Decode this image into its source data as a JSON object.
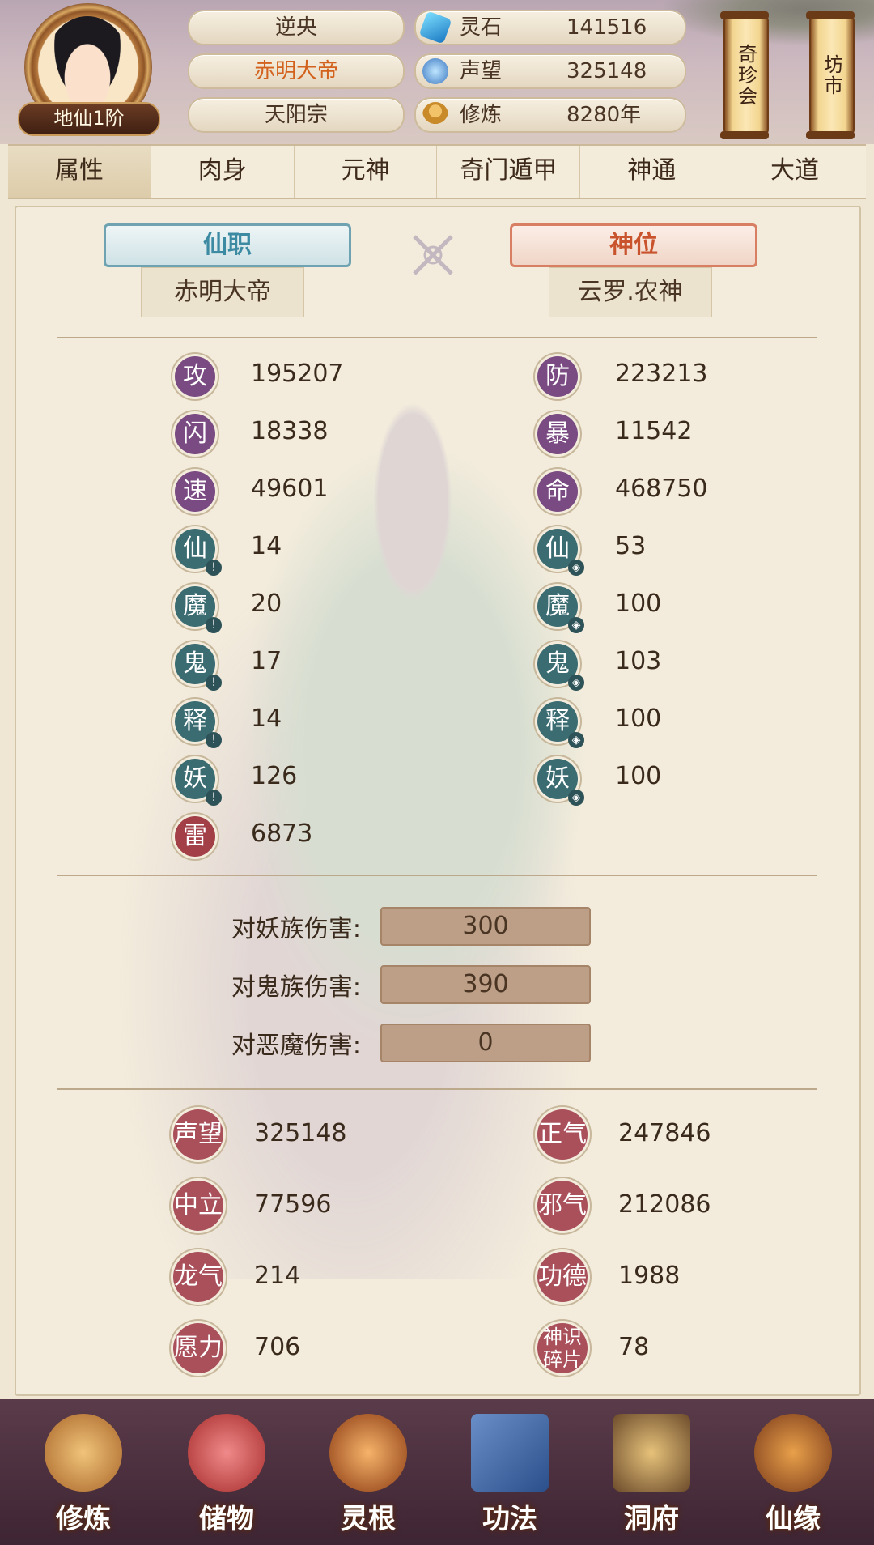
{
  "header": {
    "rank": "地仙1阶",
    "name": "逆央",
    "title": "赤明大帝",
    "sect": "天阳宗",
    "currencies": [
      {
        "icon": "spirit-stone-icon",
        "label": "灵石",
        "value": "141516"
      },
      {
        "icon": "reputation-icon",
        "label": "声望",
        "value": "325148"
      },
      {
        "icon": "cultivation-icon",
        "label": "修炼",
        "value": "8280年"
      }
    ],
    "scroll_buttons": [
      "奇珍会",
      "坊市"
    ]
  },
  "tabs": [
    "属性",
    "肉身",
    "元神",
    "奇门遁甲",
    "神通",
    "大道"
  ],
  "active_tab": 0,
  "titles": {
    "office_label": "仙职",
    "office_value": "赤明大帝",
    "divine_label": "神位",
    "divine_value": "云罗.农神"
  },
  "stats_left": [
    {
      "badge": "攻",
      "value": "195207",
      "style": "purple"
    },
    {
      "badge": "闪",
      "value": "18338",
      "style": "purple"
    },
    {
      "badge": "速",
      "value": "49601",
      "style": "purple"
    },
    {
      "badge": "仙",
      "value": "14",
      "style": "teal"
    },
    {
      "badge": "魔",
      "value": "20",
      "style": "teal"
    },
    {
      "badge": "鬼",
      "value": "17",
      "style": "teal"
    },
    {
      "badge": "释",
      "value": "14",
      "style": "teal"
    },
    {
      "badge": "妖",
      "value": "126",
      "style": "teal"
    },
    {
      "badge": "雷",
      "value": "6873",
      "style": "red"
    }
  ],
  "stats_right": [
    {
      "badge": "防",
      "value": "223213",
      "style": "purple"
    },
    {
      "badge": "暴",
      "value": "11542",
      "style": "purple"
    },
    {
      "badge": "命",
      "value": "468750",
      "style": "purple"
    },
    {
      "badge": "仙",
      "value": "53",
      "style": "teal"
    },
    {
      "badge": "魔",
      "value": "100",
      "style": "teal"
    },
    {
      "badge": "鬼",
      "value": "103",
      "style": "teal"
    },
    {
      "badge": "释",
      "value": "100",
      "style": "teal"
    },
    {
      "badge": "妖",
      "value": "100",
      "style": "teal"
    }
  ],
  "damage": [
    {
      "label": "对妖族伤害:",
      "value": "300"
    },
    {
      "label": "对鬼族伤害:",
      "value": "390"
    },
    {
      "label": "对恶魔伤害:",
      "value": "0"
    }
  ],
  "reputation_left": [
    {
      "badge": "声望",
      "value": "325148"
    },
    {
      "badge": "中立",
      "value": "77596"
    },
    {
      "badge": "龙气",
      "value": "214"
    },
    {
      "badge": "愿力",
      "value": "706"
    }
  ],
  "reputation_right": [
    {
      "badge": "正气",
      "value": "247846"
    },
    {
      "badge": "邪气",
      "value": "212086"
    },
    {
      "badge": "功德",
      "value": "1988"
    },
    {
      "badge": "神识碎片",
      "value": "78"
    }
  ],
  "bottom_nav": [
    "修炼",
    "储物",
    "灵根",
    "功法",
    "洞府",
    "仙缘"
  ]
}
